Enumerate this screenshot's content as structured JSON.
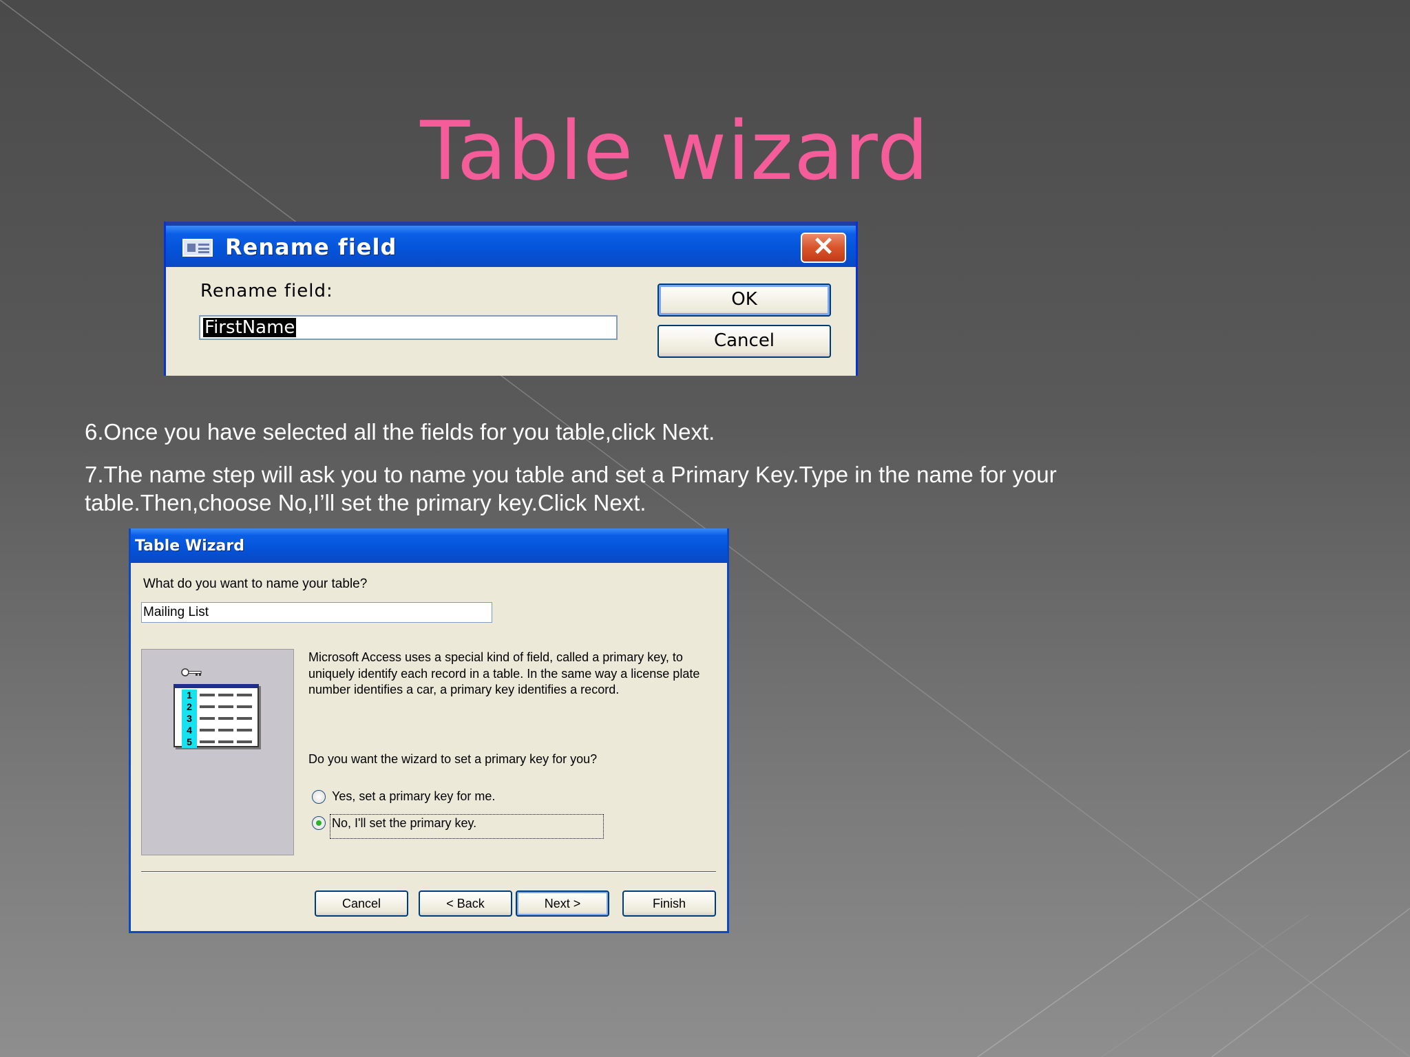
{
  "slide": {
    "title": "Table wizard",
    "step6": "6.Once you have selected all the fields for you table,click Next.",
    "step7_line1": "7.The name step will ask you to name you table and set a Primary Key.Type in the name for your",
    "step7_line2": "table.Then,choose No,I’ll set the primary key.Click Next."
  },
  "rename_dialog": {
    "title": "Rename field",
    "field_label": "Rename field:",
    "field_value": "FirstName",
    "ok_label": "OK",
    "cancel_label": "Cancel",
    "close_glyph": "✕"
  },
  "table_wizard": {
    "title": "Table Wizard",
    "question": "What do you want to name your table?",
    "table_name": "Mailing List",
    "description": "Microsoft Access uses a special kind of field, called a primary key, to uniquely identify each record in a table. In the same way a license plate number identifies a car, a primary key identifies a record.",
    "pk_question": "Do you want the wizard to set a primary key for you?",
    "option_yes": "Yes, set a primary key for me.",
    "option_no": "No, I'll set the primary key.",
    "selected_option": "no",
    "row_numbers": [
      "1",
      "2",
      "3",
      "4",
      "5"
    ],
    "buttons": {
      "cancel": "Cancel",
      "back": "< Back",
      "next": "Next >",
      "finish": "Finish"
    }
  },
  "colors": {
    "title_pink": "#f45c9a",
    "xp_blue": "#0553d8",
    "dialog_bg": "#ece9d8"
  }
}
